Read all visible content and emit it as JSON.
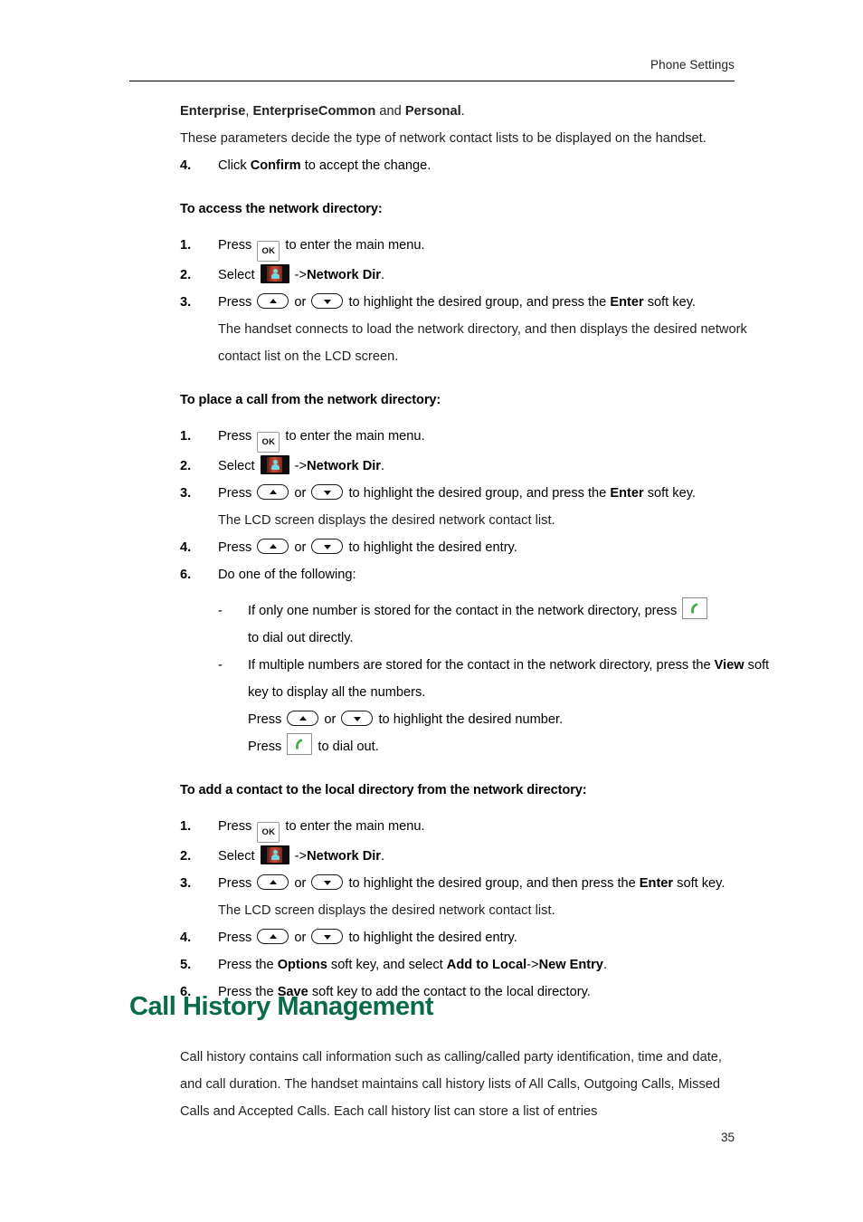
{
  "header": {
    "running_head": "Phone Settings"
  },
  "footer": {
    "page_number": "35"
  },
  "colors": {
    "heading_green": "#0a6b4a",
    "body_text": "#231f20",
    "icon_book_red": "#cf4a36",
    "icon_person_blue": "#6fd8e0",
    "icon_call_green": "#3fae3f"
  },
  "body": {
    "intro": {
      "bold_terms_line": {
        "t1": "Enterprise",
        "sep1": ", ",
        "t2": "EnterpriseCommon",
        "sep2": " and ",
        "t3": "Personal",
        "end": "."
      },
      "paragraph": "These parameters decide the type of network contact lists to be displayed on the handset.",
      "step4": {
        "num": "4.",
        "pre": "Click ",
        "bold": "Confirm",
        "post": " to accept the change."
      }
    },
    "section_access": {
      "heading": "To access the network directory:",
      "steps": [
        {
          "num": "1.",
          "pre": "Press ",
          "icon": "ok-key-icon",
          "icon_label": "OK",
          "post": " to enter the main menu."
        },
        {
          "num": "2.",
          "pre": "Select ",
          "icon": "directory-icon",
          "mid": " ->",
          "bold": "Network Dir",
          "post": "."
        },
        {
          "num": "3.",
          "pre": "Press ",
          "icon_up": "arrow-up-key-icon",
          "mid1": " or ",
          "icon_down": "arrow-down-key-icon",
          "mid2": " to highlight the desired group, and press the ",
          "bold": "Enter",
          "post": " soft key."
        }
      ],
      "note": "The handset connects to load the network directory, and then displays the desired network contact list on the LCD screen."
    },
    "section_place_call": {
      "heading": "To place a call from the network directory:",
      "steps": [
        {
          "num": "1.",
          "pre": "Press ",
          "icon": "ok-key-icon",
          "icon_label": "OK",
          "post": " to enter the main menu."
        },
        {
          "num": "2.",
          "pre": "Select ",
          "icon": "directory-icon",
          "mid": " ->",
          "bold": "Network Dir",
          "post": "."
        },
        {
          "num": "3.",
          "pre": "Press ",
          "icon_up": "arrow-up-key-icon",
          "mid1": " or ",
          "icon_down": "arrow-down-key-icon",
          "mid2": " to highlight the desired group, and press the ",
          "bold": "Enter",
          "post": " soft key."
        }
      ],
      "note_after_step3": "The LCD screen displays the desired network contact list.",
      "step4": {
        "num": "4.",
        "pre": "Press ",
        "mid1": " or ",
        "post": " to highlight the desired entry."
      },
      "step6": {
        "num": "6.",
        "text": "Do one of the following:"
      },
      "bullets": [
        {
          "dash": "-",
          "pre": "If only one number is stored for the contact in the network directory, press ",
          "icon": "call-key-icon",
          "cont": "to dial out directly."
        },
        {
          "dash": "-",
          "pre": "If multiple numbers are stored for the contact in the network directory, press the ",
          "bold": "View",
          "post": " soft key to display all the numbers.",
          "sub1_pre": "Press ",
          "sub1_mid": " or ",
          "sub1_post": " to highlight the desired number.",
          "sub2_pre": "Press ",
          "sub2_post": " to dial out."
        }
      ]
    },
    "section_add_contact": {
      "heading": "To add a contact to the local directory from the network directory:",
      "steps": [
        {
          "num": "1.",
          "pre": "Press ",
          "icon": "ok-key-icon",
          "icon_label": "OK",
          "post": " to enter the main menu."
        },
        {
          "num": "2.",
          "pre": "Select ",
          "icon": "directory-icon",
          "mid": " ->",
          "bold": "Network Dir",
          "post": "."
        },
        {
          "num": "3.",
          "pre": "Press ",
          "mid1": " or ",
          "mid2": " to highlight the desired group, and then press the ",
          "bold": "Enter",
          "post": " soft key."
        }
      ],
      "note_after_step3": "The LCD screen displays the desired network contact list.",
      "step4": {
        "num": "4.",
        "pre": "Press ",
        "mid1": " or ",
        "post": " to highlight the desired entry."
      },
      "step5": {
        "num": "5.",
        "pre": "Press the ",
        "bold1": "Options",
        "mid": " soft key, and select ",
        "bold2": "Add to Local",
        "mid2": "->",
        "bold3": "New Entry",
        "post": "."
      },
      "step6": {
        "num": "6.",
        "pre": "Press the ",
        "bold": "Save",
        "post": " soft key to add the contact to the local directory."
      }
    },
    "section_call_history": {
      "heading": "Call History Management",
      "paragraph": "Call history contains call information such as calling/called party identification, time and date, and call duration. The handset maintains call history lists of All Calls, Outgoing Calls, Missed Calls and Accepted Calls. Each call history list can store a list of entries"
    }
  }
}
